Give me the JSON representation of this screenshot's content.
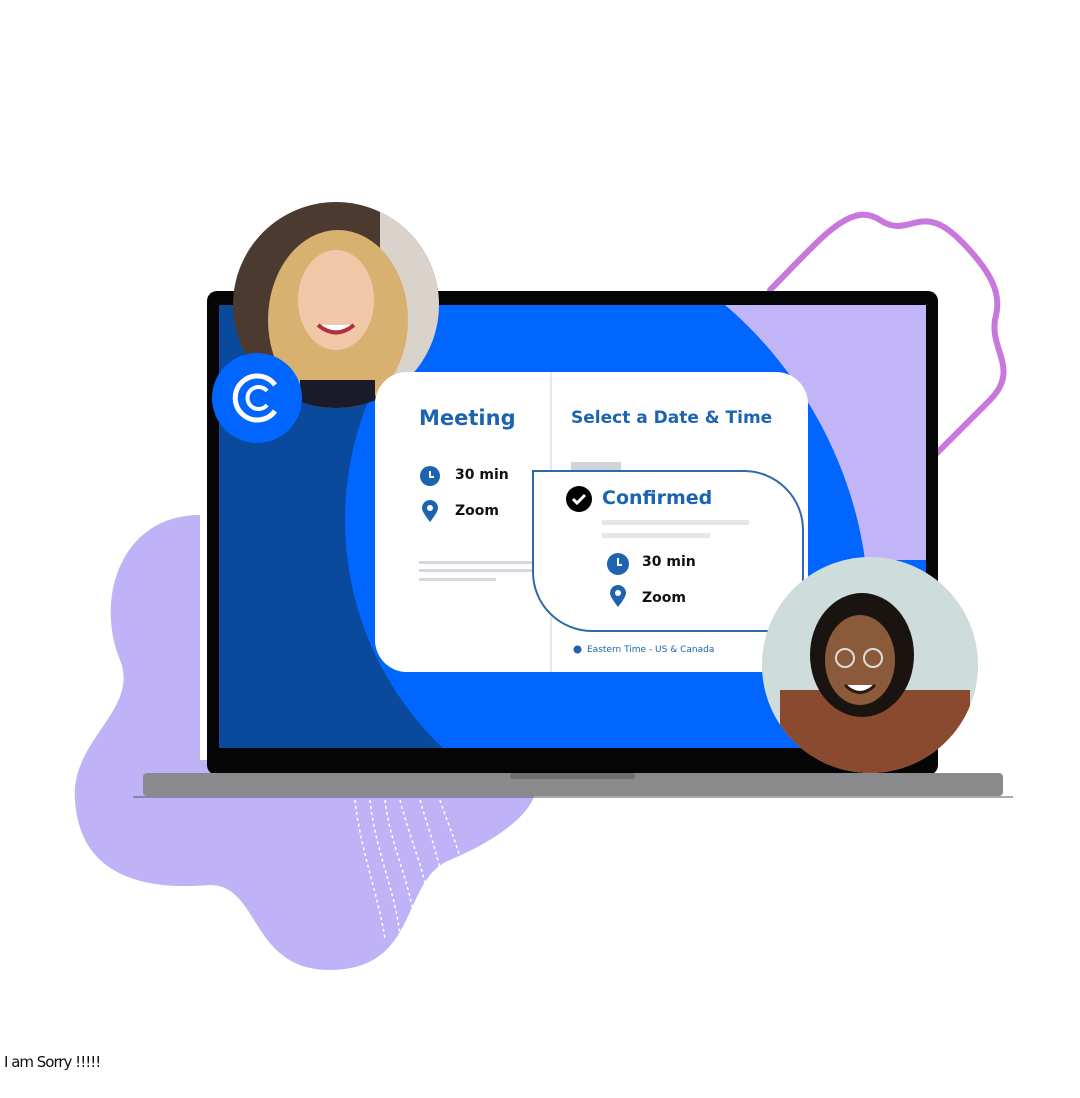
{
  "colors": {
    "brand_blue": "#0066ff",
    "dark_blue": "#0a4a9c",
    "lavender": "#bfb2f6",
    "squiggle": "#c878dc",
    "heading": "#1d64b0"
  },
  "booking_card": {
    "meeting_title": "Meeting",
    "select_title": "Select a Date & Time",
    "duration": "30 min",
    "location": "Zoom",
    "timezone": "Eastern Time - US & Canada"
  },
  "confirmation": {
    "status": "Confirmed",
    "duration": "30 min",
    "location": "Zoom"
  },
  "icons": [
    "calendly-logo-icon",
    "clock-icon",
    "location-pin-icon",
    "check-circle-icon",
    "globe-icon"
  ],
  "caption": "I am Sorry !!!!!"
}
